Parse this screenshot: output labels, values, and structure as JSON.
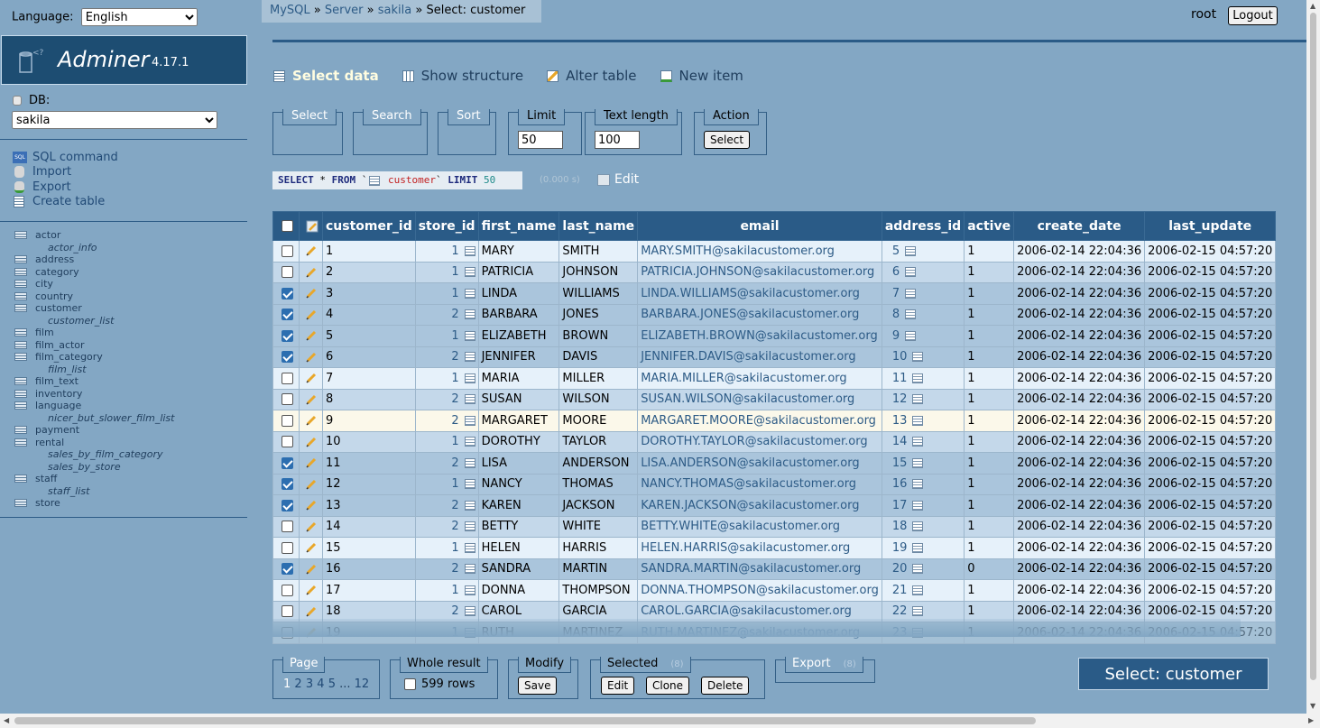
{
  "language": {
    "label": "Language:",
    "value": "English"
  },
  "logo": {
    "name": "Adminer",
    "version": "4.17.1"
  },
  "db": {
    "label": "DB:",
    "value": "sakila"
  },
  "menu": [
    "SQL command",
    "Import",
    "Export",
    "Create table"
  ],
  "tables": [
    {
      "name": "actor",
      "view": false
    },
    {
      "name": "actor_info",
      "view": true
    },
    {
      "name": "address",
      "view": false
    },
    {
      "name": "category",
      "view": false
    },
    {
      "name": "city",
      "view": false
    },
    {
      "name": "country",
      "view": false
    },
    {
      "name": "customer",
      "view": false
    },
    {
      "name": "customer_list",
      "view": true
    },
    {
      "name": "film",
      "view": false
    },
    {
      "name": "film_actor",
      "view": false
    },
    {
      "name": "film_category",
      "view": false
    },
    {
      "name": "film_list",
      "view": true
    },
    {
      "name": "film_text",
      "view": false
    },
    {
      "name": "inventory",
      "view": false
    },
    {
      "name": "language",
      "view": false
    },
    {
      "name": "nicer_but_slower_film_list",
      "view": true
    },
    {
      "name": "payment",
      "view": false
    },
    {
      "name": "rental",
      "view": false
    },
    {
      "name": "sales_by_film_category",
      "view": true
    },
    {
      "name": "sales_by_store",
      "view": true
    },
    {
      "name": "staff",
      "view": false
    },
    {
      "name": "staff_list",
      "view": true
    },
    {
      "name": "store",
      "view": false
    }
  ],
  "breadcrumb": {
    "mysql": "MySQL",
    "sep": "»",
    "server": "Server",
    "db": "sakila",
    "current": "Select: customer"
  },
  "user": {
    "name": "root",
    "logout": "Logout"
  },
  "links": [
    "Select data",
    "Show structure",
    "Alter table",
    "New item"
  ],
  "form": {
    "select": "Select",
    "search": "Search",
    "sort": "Sort",
    "limit_label": "Limit",
    "limit": "50",
    "textlen_label": "Text length",
    "textlen": "100",
    "action_label": "Action",
    "action_button": "Select"
  },
  "sql": {
    "select": "SELECT",
    "star": "*",
    "from": "FROM",
    "table": "customer",
    "limit": "LIMIT",
    "limit_val": "50",
    "time": "(0.000 s)",
    "edit": "Edit"
  },
  "columns": [
    "customer_id",
    "store_id",
    "first_name",
    "last_name",
    "email",
    "address_id",
    "active",
    "create_date",
    "last_update"
  ],
  "rows": [
    {
      "checked": false,
      "id": "1",
      "store": "1",
      "first": "MARY",
      "last": "SMITH",
      "email": "MARY.SMITH@sakilacustomer.org",
      "addr": "5",
      "active": "1",
      "created": "2006-02-14 22:04:36",
      "updated": "2006-02-15 04:57:20"
    },
    {
      "checked": false,
      "id": "2",
      "store": "1",
      "first": "PATRICIA",
      "last": "JOHNSON",
      "email": "PATRICIA.JOHNSON@sakilacustomer.org",
      "addr": "6",
      "active": "1",
      "created": "2006-02-14 22:04:36",
      "updated": "2006-02-15 04:57:20"
    },
    {
      "checked": true,
      "id": "3",
      "store": "1",
      "first": "LINDA",
      "last": "WILLIAMS",
      "email": "LINDA.WILLIAMS@sakilacustomer.org",
      "addr": "7",
      "active": "1",
      "created": "2006-02-14 22:04:36",
      "updated": "2006-02-15 04:57:20"
    },
    {
      "checked": true,
      "id": "4",
      "store": "2",
      "first": "BARBARA",
      "last": "JONES",
      "email": "BARBARA.JONES@sakilacustomer.org",
      "addr": "8",
      "active": "1",
      "created": "2006-02-14 22:04:36",
      "updated": "2006-02-15 04:57:20"
    },
    {
      "checked": true,
      "id": "5",
      "store": "1",
      "first": "ELIZABETH",
      "last": "BROWN",
      "email": "ELIZABETH.BROWN@sakilacustomer.org",
      "addr": "9",
      "active": "1",
      "created": "2006-02-14 22:04:36",
      "updated": "2006-02-15 04:57:20"
    },
    {
      "checked": true,
      "id": "6",
      "store": "2",
      "first": "JENNIFER",
      "last": "DAVIS",
      "email": "JENNIFER.DAVIS@sakilacustomer.org",
      "addr": "10",
      "active": "1",
      "created": "2006-02-14 22:04:36",
      "updated": "2006-02-15 04:57:20"
    },
    {
      "checked": false,
      "id": "7",
      "store": "1",
      "first": "MARIA",
      "last": "MILLER",
      "email": "MARIA.MILLER@sakilacustomer.org",
      "addr": "11",
      "active": "1",
      "created": "2006-02-14 22:04:36",
      "updated": "2006-02-15 04:57:20"
    },
    {
      "checked": false,
      "id": "8",
      "store": "2",
      "first": "SUSAN",
      "last": "WILSON",
      "email": "SUSAN.WILSON@sakilacustomer.org",
      "addr": "12",
      "active": "1",
      "created": "2006-02-14 22:04:36",
      "updated": "2006-02-15 04:57:20"
    },
    {
      "checked": false,
      "id": "9",
      "store": "2",
      "first": "MARGARET",
      "last": "MOORE",
      "email": "MARGARET.MOORE@sakilacustomer.org",
      "addr": "13",
      "active": "1",
      "created": "2006-02-14 22:04:36",
      "updated": "2006-02-15 04:57:20",
      "hover": true
    },
    {
      "checked": false,
      "id": "10",
      "store": "1",
      "first": "DOROTHY",
      "last": "TAYLOR",
      "email": "DOROTHY.TAYLOR@sakilacustomer.org",
      "addr": "14",
      "active": "1",
      "created": "2006-02-14 22:04:36",
      "updated": "2006-02-15 04:57:20"
    },
    {
      "checked": true,
      "id": "11",
      "store": "2",
      "first": "LISA",
      "last": "ANDERSON",
      "email": "LISA.ANDERSON@sakilacustomer.org",
      "addr": "15",
      "active": "1",
      "created": "2006-02-14 22:04:36",
      "updated": "2006-02-15 04:57:20"
    },
    {
      "checked": true,
      "id": "12",
      "store": "1",
      "first": "NANCY",
      "last": "THOMAS",
      "email": "NANCY.THOMAS@sakilacustomer.org",
      "addr": "16",
      "active": "1",
      "created": "2006-02-14 22:04:36",
      "updated": "2006-02-15 04:57:20"
    },
    {
      "checked": true,
      "id": "13",
      "store": "2",
      "first": "KAREN",
      "last": "JACKSON",
      "email": "KAREN.JACKSON@sakilacustomer.org",
      "addr": "17",
      "active": "1",
      "created": "2006-02-14 22:04:36",
      "updated": "2006-02-15 04:57:20"
    },
    {
      "checked": false,
      "id": "14",
      "store": "2",
      "first": "BETTY",
      "last": "WHITE",
      "email": "BETTY.WHITE@sakilacustomer.org",
      "addr": "18",
      "active": "1",
      "created": "2006-02-14 22:04:36",
      "updated": "2006-02-15 04:57:20"
    },
    {
      "checked": false,
      "id": "15",
      "store": "1",
      "first": "HELEN",
      "last": "HARRIS",
      "email": "HELEN.HARRIS@sakilacustomer.org",
      "addr": "19",
      "active": "1",
      "created": "2006-02-14 22:04:36",
      "updated": "2006-02-15 04:57:20"
    },
    {
      "checked": true,
      "id": "16",
      "store": "2",
      "first": "SANDRA",
      "last": "MARTIN",
      "email": "SANDRA.MARTIN@sakilacustomer.org",
      "addr": "20",
      "active": "0",
      "created": "2006-02-14 22:04:36",
      "updated": "2006-02-15 04:57:20"
    },
    {
      "checked": false,
      "id": "17",
      "store": "1",
      "first": "DONNA",
      "last": "THOMPSON",
      "email": "DONNA.THOMPSON@sakilacustomer.org",
      "addr": "21",
      "active": "1",
      "created": "2006-02-14 22:04:36",
      "updated": "2006-02-15 04:57:20"
    },
    {
      "checked": false,
      "id": "18",
      "store": "2",
      "first": "CAROL",
      "last": "GARCIA",
      "email": "CAROL.GARCIA@sakilacustomer.org",
      "addr": "22",
      "active": "1",
      "created": "2006-02-14 22:04:36",
      "updated": "2006-02-15 04:57:20"
    },
    {
      "checked": false,
      "id": "19",
      "store": "1",
      "first": "RUTH",
      "last": "MARTINEZ",
      "email": "RUTH.MARTINEZ@sakilacustomer.org",
      "addr": "23",
      "active": "1",
      "created": "2006-02-14 22:04:36",
      "updated": "2006-02-15 04:57:20"
    }
  ],
  "bottom": {
    "page_label": "Page",
    "pages": [
      "1",
      "2",
      "3",
      "4",
      "5",
      "...",
      "12"
    ],
    "whole_label": "Whole result",
    "rows": "599 rows",
    "modify_label": "Modify",
    "save": "Save",
    "selected_label": "Selected",
    "selected_count": "(8)",
    "edit": "Edit",
    "clone": "Clone",
    "delete": "Delete",
    "export_label": "Export",
    "export_count": "(8)"
  },
  "title_box": "Select: customer",
  "colors": {
    "background": "#83a7c4",
    "header": "#2a5b87",
    "logo": "#1d4d72"
  }
}
